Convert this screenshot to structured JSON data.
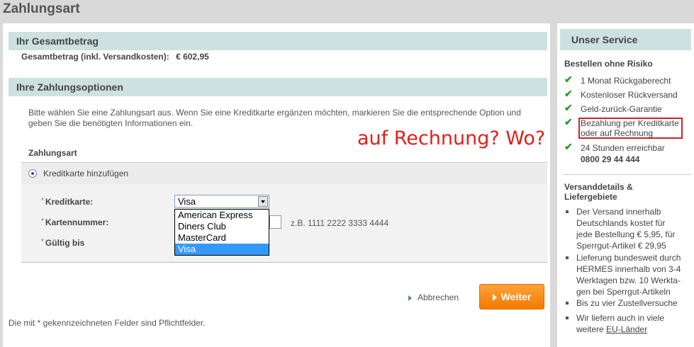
{
  "page_title": "Zahlungsart",
  "total": {
    "header": "Ihr Gesamtbetrag",
    "label": "Gesamtbetrag (inkl. Versandkosten):",
    "value": "€ 602,95"
  },
  "payment": {
    "header": "Ihre Zahlungsoptionen",
    "intro": "Bitte wählen Sie eine Zahlungsart aus. Wenn Sie eine Kreditkarte ergänzen möchten, markieren Sie die entsprechende Option und geben Sie die benötigten Informationen ein.",
    "annotation": "auf Rechnung? Wo?",
    "zahlungsart_label": "Zahlungsart",
    "option_label": "Kreditkarte hinzufügen",
    "fields": {
      "star": "*",
      "card_label": "Kreditkarte:",
      "number_label": "Kartennummer:",
      "expiry_label": "Gültig bis"
    },
    "card_select": {
      "value": "Visa",
      "options": [
        "American Express",
        "Diners Club",
        "MasterCard",
        "Visa"
      ]
    },
    "number_hint": "z.B. 1111 2222 3333 4444",
    "cancel_label": "Abbrechen",
    "next_label": "Weiter",
    "footnote": "Die mit * gekennzeichneten Felder sind Pflichtfelder."
  },
  "sidebar": {
    "header": "Unser Service",
    "risk_title": "Bestellen ohne Risiko",
    "checks": [
      "1 Monat Rückgaberecht",
      "Kostenloser Rückversand",
      "Geld-zurück-Garantie",
      "Bezahlung per Kreditkarte",
      "oder auf Rechnung",
      "24 Stunden erreichbar"
    ],
    "phone": "0800 29 44 444",
    "shipping_title_1": "Versanddetails &",
    "shipping_title_2": "Liefergebiete",
    "bullets": [
      [
        "Der Versand innerhalb",
        "Deutschlands kostet für",
        "jede Bestellung € 5,95, für",
        "Sperrgut-Artikel € 29,95"
      ],
      [
        "Lieferung bundesweit durch",
        "HERMES innerhalb von 3-4",
        "Werktagen bzw. 10 Werkta-",
        "gen bei Sperrgut-Artikeln"
      ],
      [
        "Bis zu vier Zustellversuche"
      ],
      [
        "Wir liefern auch in viele",
        "weitere "
      ]
    ],
    "eu_link": "EU-Länder"
  },
  "colors": {
    "section_header_bg": "#cde1e1",
    "button_orange": "#f47a00",
    "annotation_red": "#e0201b",
    "check_green": "#2e9b2e",
    "selected_blue": "#3399ff"
  }
}
